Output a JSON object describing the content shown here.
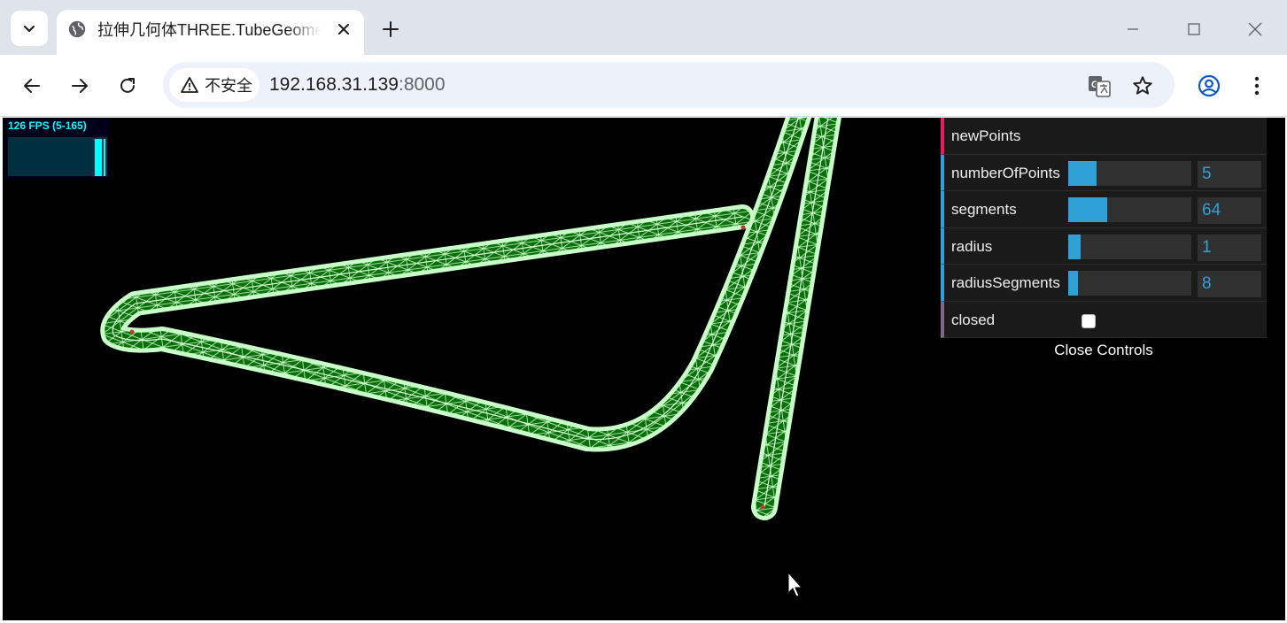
{
  "browser": {
    "tab_title": "拉伸几何体THREE.TubeGeometry",
    "security_label": "不安全",
    "url_host": "192.168.31.139",
    "url_port": ":8000"
  },
  "stats": {
    "fps_text": "126 FPS (5-165)"
  },
  "gui": {
    "controls": [
      {
        "label": "newPoints",
        "kind": "function"
      },
      {
        "label": "numberOfPoints",
        "kind": "number",
        "value": "5",
        "fill_fraction": 0.23
      },
      {
        "label": "segments",
        "kind": "number",
        "value": "64",
        "fill_fraction": 0.32
      },
      {
        "label": "radius",
        "kind": "number",
        "value": "1",
        "fill_fraction": 0.1
      },
      {
        "label": "radiusSegments",
        "kind": "number",
        "value": "8",
        "fill_fraction": 0.08
      },
      {
        "label": "closed",
        "kind": "boolean",
        "checked": false
      }
    ],
    "close_label": "Close Controls"
  },
  "colors": {
    "accent": "#2fa1d6",
    "function_accent": "#e61d5f",
    "tube_wire": "#c8ffc8",
    "tube_fill": "#0a6e0a"
  },
  "icons": [
    "tab-search-icon",
    "globe-icon",
    "close-icon",
    "plus-icon",
    "minimize-icon",
    "maximize-icon",
    "window-close-icon",
    "back-arrow-icon",
    "forward-arrow-icon",
    "reload-icon",
    "warning-icon",
    "translate-icon",
    "star-icon",
    "profile-icon",
    "kebab-menu-icon",
    "mouse-cursor-icon"
  ]
}
